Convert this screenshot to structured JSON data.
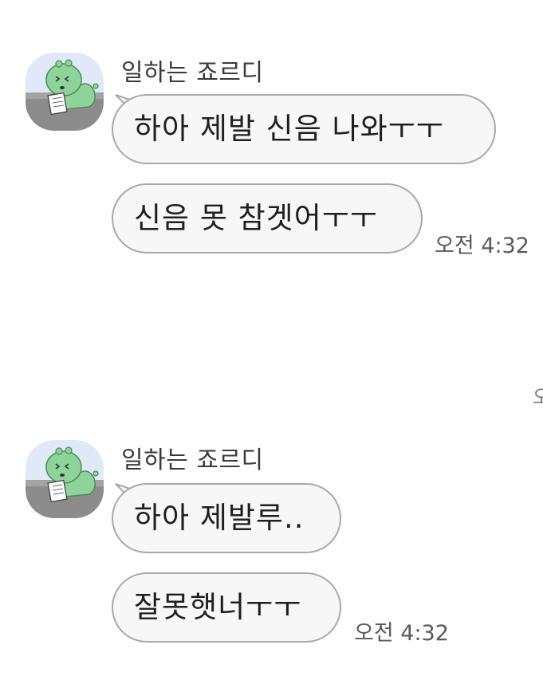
{
  "groups": [
    {
      "sender": "일하는 죠르디",
      "messages": [
        {
          "text": "하아 제발 신음 나와ㅜㅜ"
        },
        {
          "text": "신음 못 참겟어ㅜㅜ"
        }
      ],
      "time": "오전 4:32"
    },
    {
      "sender": "일하는 죠르디",
      "messages": [
        {
          "text": "하아 제발루.."
        },
        {
          "text": "잘못햇너ㅜㅜ"
        }
      ],
      "time": "오전 4:32"
    }
  ],
  "edge_glyph": "오",
  "avatar_icon": "jordy-working-avatar",
  "colors": {
    "avatar_bg": "#dfe9f7",
    "character": "#8ed49a",
    "bubble_bg": "#f7f7f7",
    "bubble_border": "#a9a9a9"
  }
}
